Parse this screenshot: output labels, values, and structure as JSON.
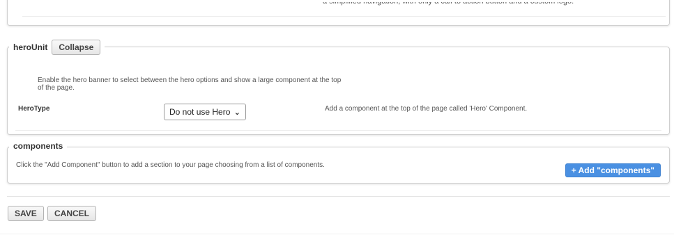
{
  "top_section": {
    "description": "a simplified navigation, with only a call to action button and a custom logo."
  },
  "hero_unit": {
    "legend": "heroUnit",
    "collapse_label": "Collapse",
    "description": "Enable the hero banner to select between the hero options and show a large component at the top of the page.",
    "herotype": {
      "label": "HeroType",
      "selected": "Do not use Hero",
      "help": "Add a component at the top of the page called 'Hero' Component."
    }
  },
  "components": {
    "legend": "components",
    "description": "Click the \"Add Component\" button to add a section to your page choosing from a list of components.",
    "add_label": "+ Add \"components\"",
    "accent_color": "#4a90e2"
  },
  "actions": {
    "save_label": "SAVE",
    "cancel_label": "CANCEL"
  }
}
